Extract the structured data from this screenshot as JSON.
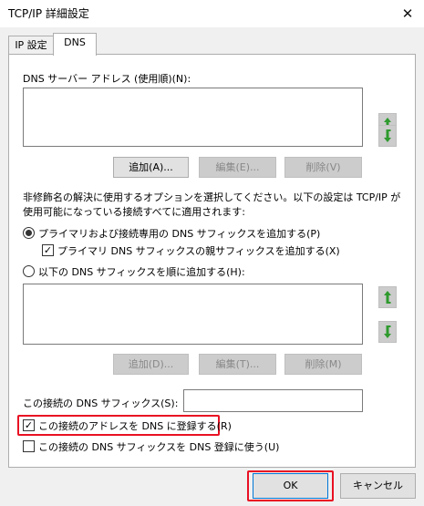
{
  "window": {
    "title": "TCP/IP 詳細設定",
    "close_glyph": "✕"
  },
  "tabs": [
    {
      "label": "IP 設定"
    },
    {
      "label": "DNS"
    }
  ],
  "dns_servers": {
    "label": "DNS サーバー アドレス (使用順)(N):",
    "items": [],
    "add": "追加(A)...",
    "edit": "編集(E)...",
    "remove": "削除(V)"
  },
  "resolution": {
    "description_line1": "非修飾名の解決に使用するオプションを選択してください。以下の設定は TCP/IP が",
    "description_line2": "使用可能になっている接続すべてに適用されます:",
    "radio_primary": "プライマリおよび接続専用の DNS サフィックスを追加する(P)",
    "radio_primary_selected": true,
    "check_parent": "プライマリ DNS サフィックスの親サフィックスを追加する(X)",
    "check_parent_checked": true,
    "radio_list": "以下の DNS サフィックスを順に追加する(H):",
    "radio_list_selected": false,
    "suffix_items": [],
    "add": "追加(D)...",
    "edit": "編集(T)...",
    "remove": "削除(M)"
  },
  "connection": {
    "suffix_label": "この接続の DNS サフィックス(S):",
    "suffix_value": "",
    "register_label": "この接続のアドレスを DNS に登録する(R)",
    "register_checked": true,
    "use_suffix_label": "この接続の DNS サフィックスを DNS 登録に使う(U)",
    "use_suffix_checked": false
  },
  "footer": {
    "ok": "OK",
    "cancel": "キャンセル"
  },
  "colors": {
    "highlight": "#e81123",
    "arrow": "#2e9a2e",
    "focus_border": "#0078d7"
  },
  "icons": {
    "up": "arrow-up-icon",
    "down": "arrow-down-icon"
  }
}
